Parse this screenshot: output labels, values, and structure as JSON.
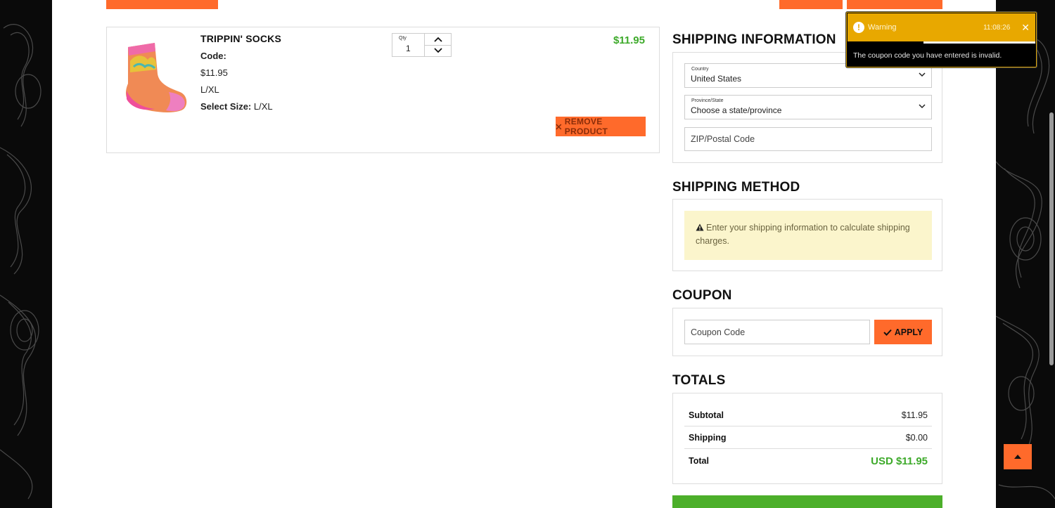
{
  "cart": {
    "item": {
      "name": "TRIPPIN' SOCKS",
      "code_label": "Code:",
      "unit_price": "$11.95",
      "variant": "L/XL",
      "size_label": "Select Size:",
      "size_value": "L/XL",
      "qty_label": "Qty",
      "qty_value": "1",
      "line_total": "$11.95",
      "remove_label": "REMOVE PRODUCT"
    }
  },
  "shipping_info": {
    "title": "SHIPPING INFORMATION",
    "country_label": "Country",
    "country_value": "United States",
    "state_label": "Province/State",
    "state_value": "Choose a state/province",
    "zip_placeholder": "ZIP/Postal Code"
  },
  "shipping_method": {
    "title": "SHIPPING METHOD",
    "notice": "Enter your shipping information to calculate shipping charges."
  },
  "coupon": {
    "title": "COUPON",
    "placeholder": "Coupon Code",
    "apply_label": "APPLY"
  },
  "totals": {
    "title": "TOTALS",
    "rows": [
      {
        "label": "Subtotal",
        "value": "$11.95"
      },
      {
        "label": "Shipping",
        "value": "$0.00"
      },
      {
        "label": "Total",
        "value": "USD $11.95"
      }
    ]
  },
  "toast": {
    "title": "Warning",
    "time": "11:08:26",
    "message": "The coupon code you have entered is invalid.",
    "close_icon": "close-icon"
  },
  "colors": {
    "accent": "#ff6a2b",
    "price_green": "#3daa2a",
    "warning": "#e8a800",
    "notice_bg": "#fbf5cc"
  }
}
